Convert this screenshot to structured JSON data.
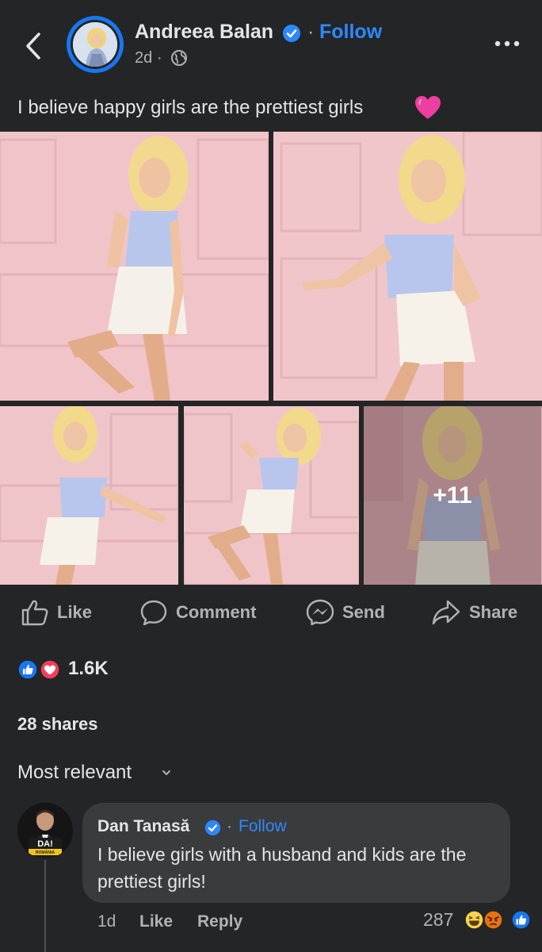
{
  "header": {
    "author": "Andreea Balan",
    "separator": "·",
    "follow": "Follow",
    "time": "2d",
    "time_separator": "·"
  },
  "post": {
    "caption": "I believe happy girls are the prettiest girls",
    "more_photos": "+11"
  },
  "actions": {
    "like": "Like",
    "comment": "Comment",
    "send": "Send",
    "share": "Share"
  },
  "stats": {
    "reactions": "1.6K",
    "shares": "28 shares"
  },
  "comments": {
    "sort_label": "Most relevant",
    "items": [
      {
        "author": "Dan Tanasă",
        "separator": "·",
        "follow": "Follow",
        "text": "I believe girls with a husband and kids are the prettiest girls!",
        "time": "1d",
        "like": "Like",
        "reply": "Reply",
        "reaction_count": "287",
        "avatar_badge": "DA!",
        "avatar_badge_sub": "ROMÂNIA"
      }
    ]
  },
  "colors": {
    "background": "#242526",
    "bubble": "#3a3b3c",
    "accent": "#2d88ff",
    "text": "#e4e6eb",
    "secondary": "#b0b3b8",
    "wall_pink": "#f1c7cc"
  }
}
